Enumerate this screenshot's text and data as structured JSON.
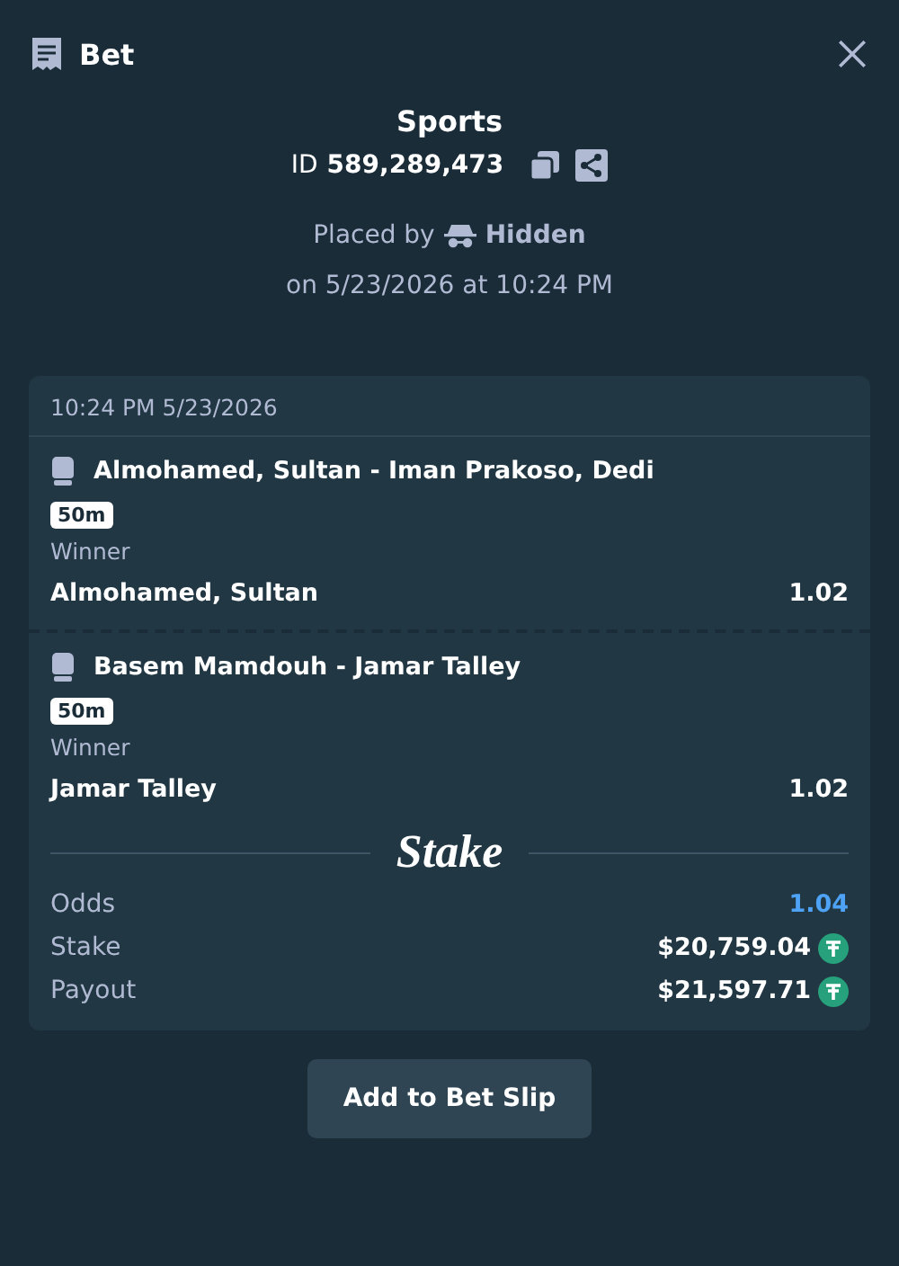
{
  "header": {
    "title": "Bet"
  },
  "summary": {
    "category": "Sports",
    "id_label": "ID",
    "id_value": "589,289,473",
    "placed_by_label": "Placed by",
    "placed_by_user": "Hidden",
    "placed_on": "on 5/23/2026 at 10:24 PM"
  },
  "card": {
    "timestamp": "10:24 PM 5/23/2026",
    "legs": [
      {
        "event": "Almohamed, Sultan - Iman Prakoso, Dedi",
        "badge": "50m",
        "market": "Winner",
        "selection": "Almohamed, Sultan",
        "odds": "1.02"
      },
      {
        "event": "Basem Mamdouh - Jamar Talley",
        "badge": "50m",
        "market": "Winner",
        "selection": "Jamar Talley",
        "odds": "1.02"
      }
    ],
    "brand": "Stake",
    "totals": [
      {
        "kind": "odds",
        "label": "Odds",
        "value": "1.04"
      },
      {
        "kind": "amount",
        "label": "Stake",
        "value": "$20,759.04"
      },
      {
        "kind": "amount",
        "label": "Payout",
        "value": "$21,597.71"
      }
    ]
  },
  "button": "Add to Bet Slip"
}
